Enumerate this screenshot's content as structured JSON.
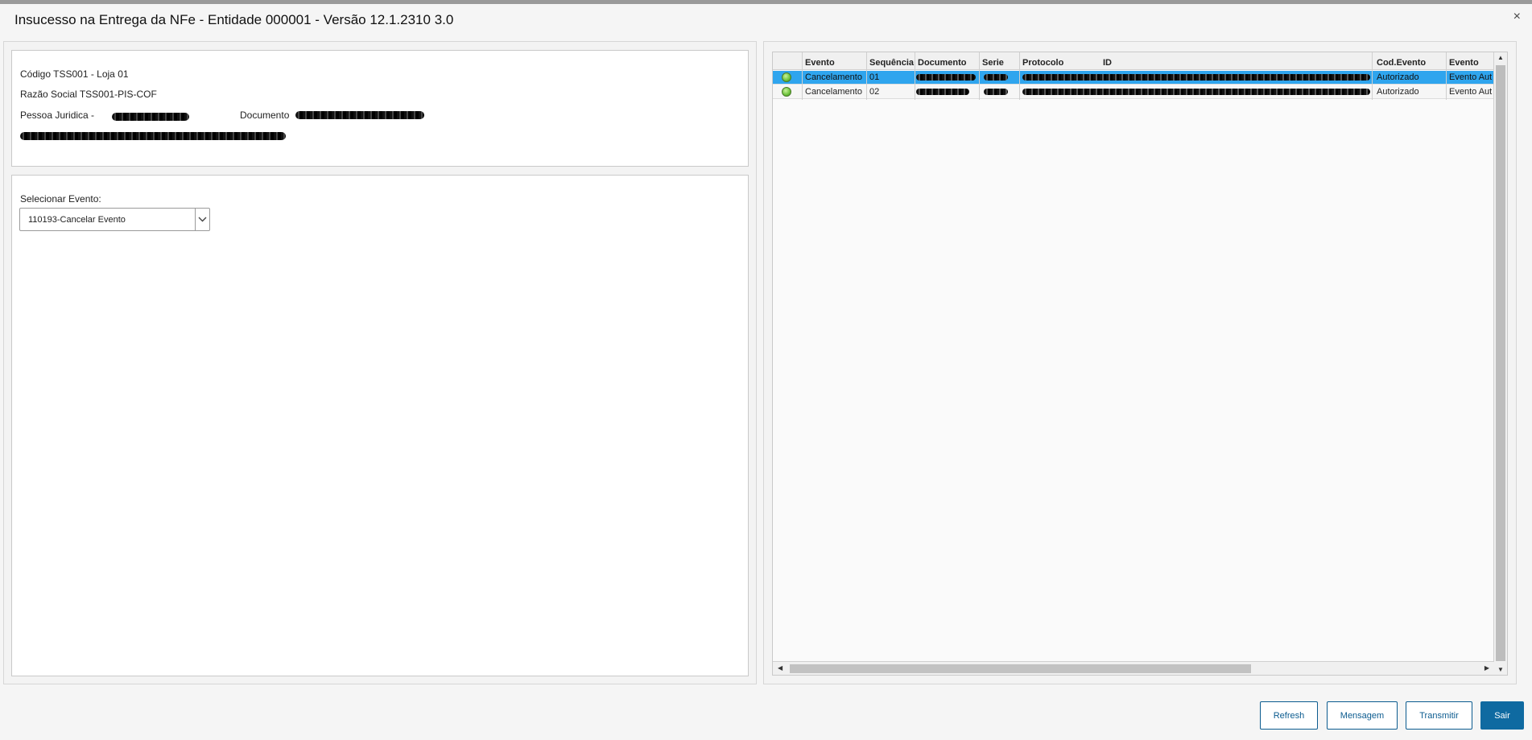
{
  "window": {
    "title": "Insucesso na Entrega da NFe - Entidade 000001 - Versão 12.1.2310  3.0",
    "close_symbol": "×"
  },
  "info": {
    "codigo": "Código TSS001 - Loja 01",
    "razao": "Razão Social TSS001-PIS-COF",
    "pessoa": "Pessoa Juridica -",
    "documento": "Documento"
  },
  "event_select": {
    "label": "Selecionar Evento:",
    "value": "110193-Cancelar Evento"
  },
  "grid": {
    "columns": [
      "Evento",
      "Sequência",
      "Documento",
      "Serie",
      "Protocolo",
      "ID",
      "Cod.Evento",
      "Evento"
    ],
    "rows": [
      {
        "evento": "Cancelamento",
        "sequencia": "01",
        "cod_evento": "Autorizado",
        "evento2": "Evento Aut",
        "status_color": "#6cc23a",
        "selected": true
      },
      {
        "evento": "Cancelamento",
        "sequencia": "02",
        "cod_evento": "Autorizado",
        "evento2": "Evento Aut",
        "status_color": "#6cc23a",
        "selected": false
      }
    ]
  },
  "buttons": {
    "refresh": "Refresh",
    "mensagem": "Mensagem",
    "transmitir": "Transmitir",
    "sair": "Sair"
  },
  "colors": {
    "selection": "#2fa5ee",
    "primary_button": "#0f6aa1"
  }
}
